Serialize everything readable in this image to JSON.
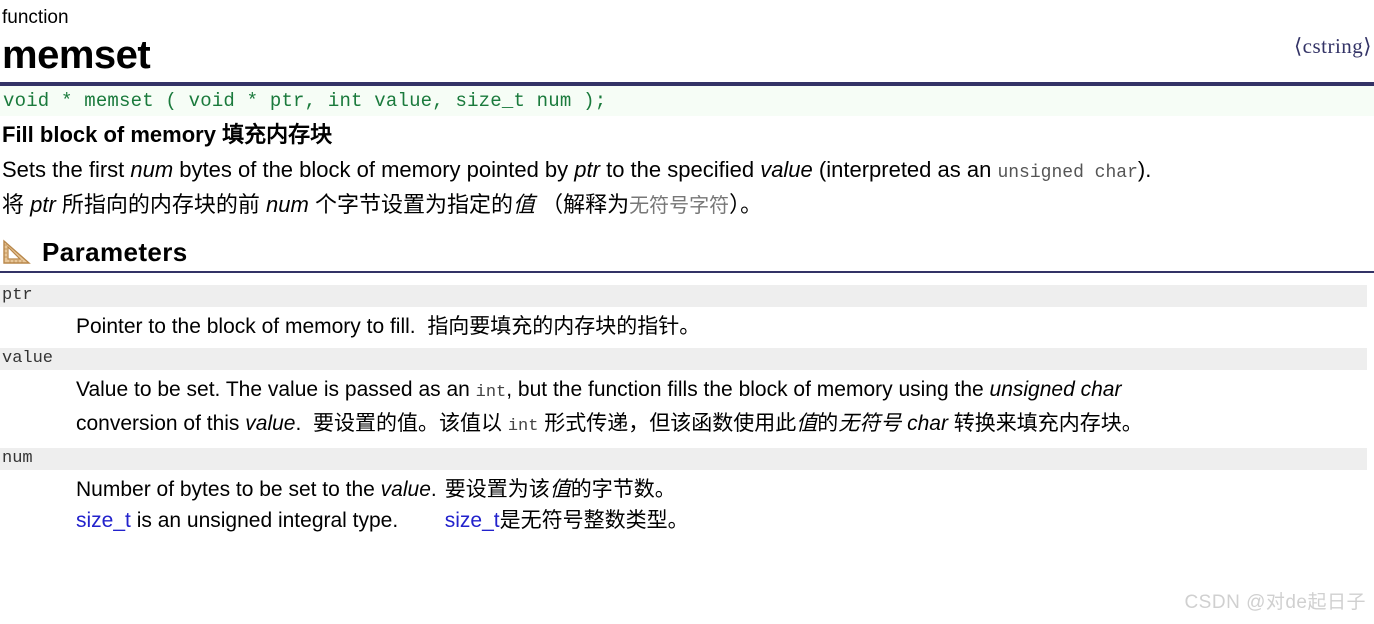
{
  "header": {
    "kind": "function",
    "name": "memset",
    "include": "⟨cstring⟩"
  },
  "signature": "void * memset ( void * ptr, int value, size_t num );",
  "description": {
    "heading_en": "Fill block of memory",
    "heading_cn": "填充内存块",
    "en_parts": {
      "p1": "Sets the first ",
      "em1": "num",
      "p2": " bytes of the block of memory pointed by ",
      "em2": "ptr",
      "p3": " to the specified ",
      "em3": "value",
      "p4": " (interpreted as an ",
      "code1": "unsigned char",
      "p5": ")."
    },
    "cn_parts": {
      "p1": "将 ",
      "em1": "ptr",
      "p2": " 所指向的内存块的前 ",
      "em2": "num",
      "p3": " 个字节设置为指定的",
      "em3": "值",
      "p4": " （解释为",
      "code1": "无符号字符",
      "p5": "）。"
    }
  },
  "parameters_section": {
    "icon": "ruler-triangle-icon",
    "title": "Parameters"
  },
  "parameters": [
    {
      "name": "ptr",
      "lines": [
        {
          "segments": [
            {
              "t": "Pointer to the block of memory to fill.  ",
              "s": "plain"
            },
            {
              "t": "指向要填充的内存块的指针。",
              "s": "cn"
            }
          ]
        }
      ]
    },
    {
      "name": "value",
      "lines": [
        {
          "segments": [
            {
              "t": "Value to be set. The value is passed as an ",
              "s": "plain"
            },
            {
              "t": "int",
              "s": "code"
            },
            {
              "t": ", but the function fills the block of memory using the ",
              "s": "plain"
            },
            {
              "t": "unsigned char",
              "s": "italic"
            }
          ]
        },
        {
          "segments": [
            {
              "t": "conversion of this ",
              "s": "plain"
            },
            {
              "t": "value",
              "s": "italic"
            },
            {
              "t": ".  ",
              "s": "plain"
            },
            {
              "t": "要设置的值。该值以 ",
              "s": "cn"
            },
            {
              "t": "int",
              "s": "code"
            },
            {
              "t": " 形式传递，但该函数使用此",
              "s": "cn"
            },
            {
              "t": "值",
              "s": "cn-italic"
            },
            {
              "t": "的",
              "s": "cn"
            },
            {
              "t": "无符号 char",
              "s": "cn-italic"
            },
            {
              "t": " 转换来填充内存块。",
              "s": "cn"
            }
          ]
        }
      ]
    },
    {
      "name": "num",
      "en_lines": [
        {
          "segments": [
            {
              "t": "Number of bytes to be set to the ",
              "s": "plain"
            },
            {
              "t": "value",
              "s": "italic"
            },
            {
              "t": ".",
              "s": "plain"
            }
          ]
        },
        {
          "segments": [
            {
              "t": "size_t",
              "s": "link"
            },
            {
              "t": " is an unsigned integral type.",
              "s": "plain"
            }
          ]
        }
      ],
      "cn_lines": [
        {
          "segments": [
            {
              "t": "要设置为该",
              "s": "cn"
            },
            {
              "t": "值",
              "s": "cn-italic"
            },
            {
              "t": "的字节数。",
              "s": "cn"
            }
          ]
        },
        {
          "segments": [
            {
              "t": "size_t",
              "s": "link"
            },
            {
              "t": "是无符号整数类型。",
              "s": "cn"
            }
          ]
        }
      ]
    }
  ],
  "watermark": "CSDN @对de起日子",
  "colors": {
    "rule": "#333366",
    "signature_text": "#1a7a3c",
    "signature_bg": "#f6fdf6",
    "param_band_bg": "#eeeeee",
    "link": "#2222cc",
    "code_gray": "#555555",
    "watermark": "#d0d0d0",
    "icon": "#d4a86a"
  }
}
